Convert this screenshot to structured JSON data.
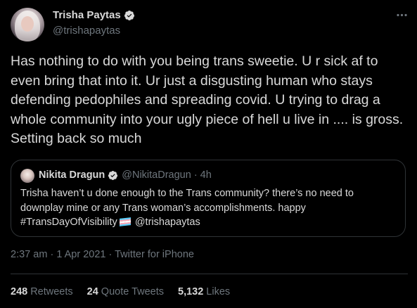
{
  "author": {
    "name": "Trisha Paytas",
    "handle": "@trishapaytas",
    "verified": true,
    "avatar_icon": "profile-photo"
  },
  "more_icon": "more-horizontal-icon",
  "tweet": {
    "text": "Has nothing to do with you being trans sweetie. U r sick af to even bring that into it. Ur just a disgusting human who stays defending pedophiles and spreading covid. U trying to drag a whole community into your ugly piece of hell u live in .... is gross. Setting back so much"
  },
  "quote": {
    "name": "Nikita Dragun",
    "handle": "@NikitaDragun",
    "separator": "·",
    "time": "4h",
    "verified": true,
    "text_part1": "Trisha haven’t u done enough to the Trans community? there’s no need to downplay mine or any Trans woman’s accomplishments. happy #TransDayOfVisibility",
    "flag_icon": "transgender-flag-icon",
    "text_part2": "@trishapaytas"
  },
  "meta": {
    "time": "2:37 am",
    "sep1": "·",
    "date": "1 Apr 2021",
    "sep2": "·",
    "source": "Twitter for iPhone"
  },
  "stats": {
    "retweets_count": "248",
    "retweets_label": "Retweets",
    "quotes_count": "24",
    "quotes_label": "Quote Tweets",
    "likes_count": "5,132",
    "likes_label": "Likes"
  },
  "colors": {
    "background": "#000000",
    "text": "#d9d9d9",
    "secondary": "#6e767d",
    "verified": "#d9d9d9",
    "border": "#2f3336"
  }
}
